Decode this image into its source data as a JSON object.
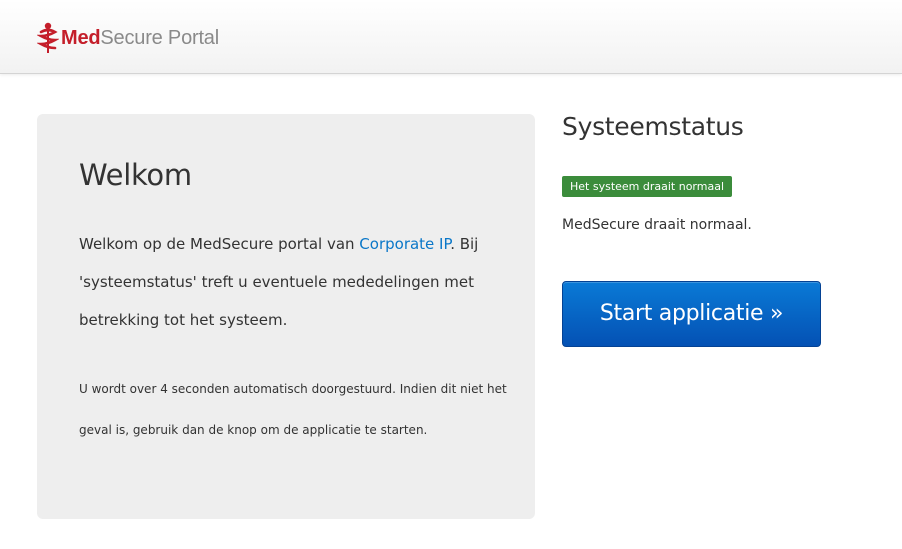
{
  "navbar": {
    "brand_bold": "Med",
    "brand_light": "Secure Portal",
    "logo_icon": "caduceus-icon",
    "brand_color": "#c41e2a"
  },
  "welcome": {
    "title": "Welkom",
    "intro_before_link": "Welkom op de MedSecure portal van ",
    "intro_link": "Corporate IP",
    "intro_after_link": ". Bij 'systeemstatus' treft u eventuele mededelingen met betrekking tot het systeem.",
    "redirect_text": "U wordt over 4 seconden automatisch doorgestuurd. Indien dit niet het geval is, gebruik dan de knop om de applicatie te starten.",
    "link_color": "#0a77c8"
  },
  "status": {
    "title": "Systeemstatus",
    "badge": "Het systeem draait normaal",
    "badge_color": "#3b8c3b",
    "message": "MedSecure draait normaal.",
    "start_button": "Start applicatie »",
    "button_color": "#0451b4"
  }
}
